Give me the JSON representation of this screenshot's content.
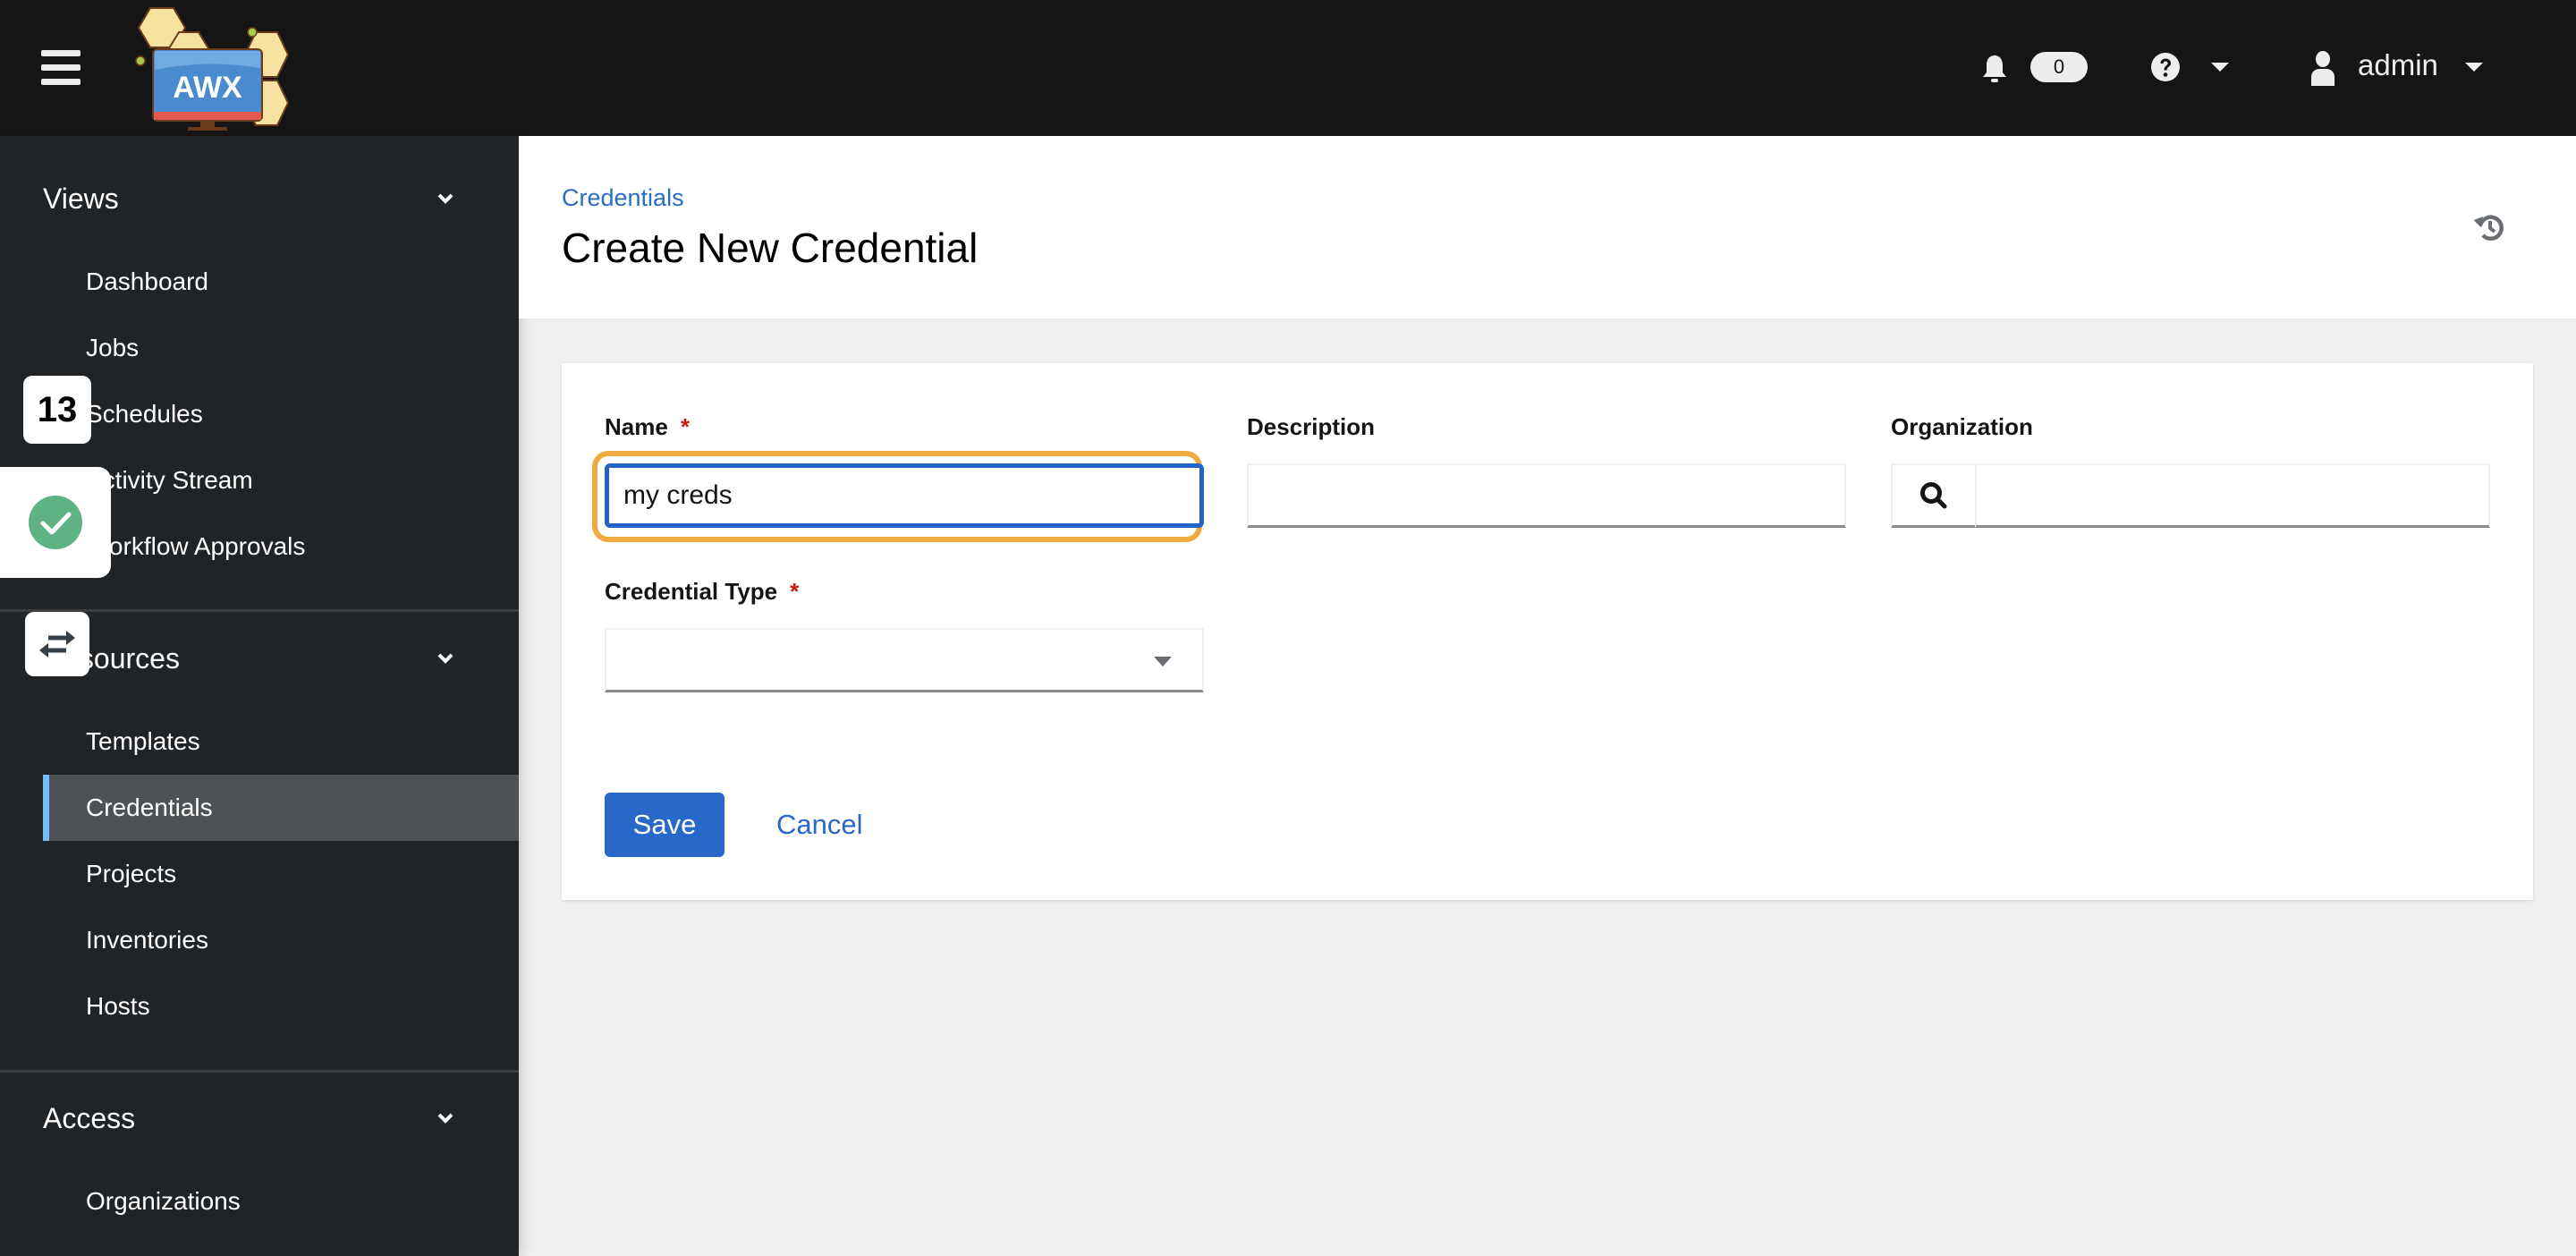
{
  "header": {
    "app_name": "AWX",
    "notification_count": "0",
    "username": "admin"
  },
  "sidebar": {
    "groups": [
      {
        "title": "Views",
        "items": [
          {
            "label": "Dashboard"
          },
          {
            "label": "Jobs"
          },
          {
            "label": "Schedules"
          },
          {
            "label": "Activity Stream"
          },
          {
            "label": "Workflow Approvals"
          }
        ]
      },
      {
        "title": "Resources",
        "items": [
          {
            "label": "Templates"
          },
          {
            "label": "Credentials",
            "active": true
          },
          {
            "label": "Projects"
          },
          {
            "label": "Inventories"
          },
          {
            "label": "Hosts"
          }
        ]
      },
      {
        "title": "Access",
        "items": [
          {
            "label": "Organizations"
          }
        ]
      }
    ]
  },
  "overlays": {
    "counter_badge": "13"
  },
  "page": {
    "breadcrumb": "Credentials",
    "title": "Create New Credential"
  },
  "form": {
    "name": {
      "label": "Name",
      "required_mark": "*",
      "value": "my creds"
    },
    "description": {
      "label": "Description",
      "value": ""
    },
    "organization": {
      "label": "Organization",
      "value": ""
    },
    "credential_type": {
      "label": "Credential Type",
      "required_mark": "*",
      "value": ""
    },
    "save_label": "Save",
    "cancel_label": "Cancel"
  },
  "colors": {
    "accent": "#2868c9",
    "focus_highlight": "#f0ab3f",
    "required": "#c9190b",
    "active_nav_indicator": "#73bcf7",
    "success": "#5fb383"
  }
}
